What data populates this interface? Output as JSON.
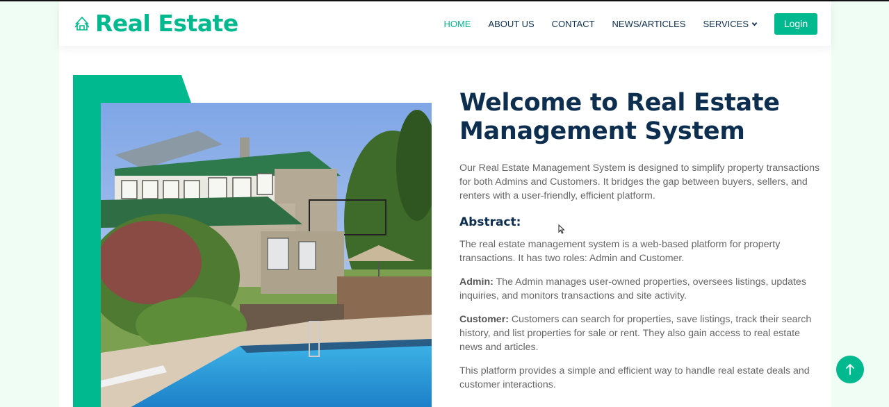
{
  "brand": {
    "name": "Real Estate",
    "icon": "building-logo-icon"
  },
  "nav": {
    "items": [
      {
        "label": "HOME",
        "active": true
      },
      {
        "label": "ABOUT US"
      },
      {
        "label": "CONTACT"
      },
      {
        "label": "NEWS/ARTICLES"
      },
      {
        "label": "SERVICES",
        "dropdown": true
      }
    ],
    "login_label": "Login"
  },
  "hero": {
    "image": "house-with-pool-photo",
    "title": "Welcome to Real Estate Management System",
    "intro": "Our Real Estate Management System is designed to simplify property transactions for both Admins and Customers. It bridges the gap between buyers, sellers, and renters with a user-friendly, efficient platform.",
    "abstract_heading": "Abstract:",
    "abstract_text": "The real estate management system is a web-based platform for property transactions. It has two roles: Admin and Customer.",
    "admin_label": "Admin:",
    "admin_text": "The Admin manages user-owned properties, oversees listings, updates inquiries, and monitors transactions and site activity.",
    "customer_label": "Customer:",
    "customer_text": "Customers can search for properties, save listings, track their search history, and list properties for sale or rent. They also gain access to real estate news and articles.",
    "closing": "This platform provides a simple and efficient way to handle real estate deals and customer interactions."
  },
  "colors": {
    "accent": "#00b98e",
    "heading": "#0e2e50",
    "body": "#666666",
    "page_bg": "#effdf4"
  },
  "scroll_top_icon": "arrow-up-icon"
}
